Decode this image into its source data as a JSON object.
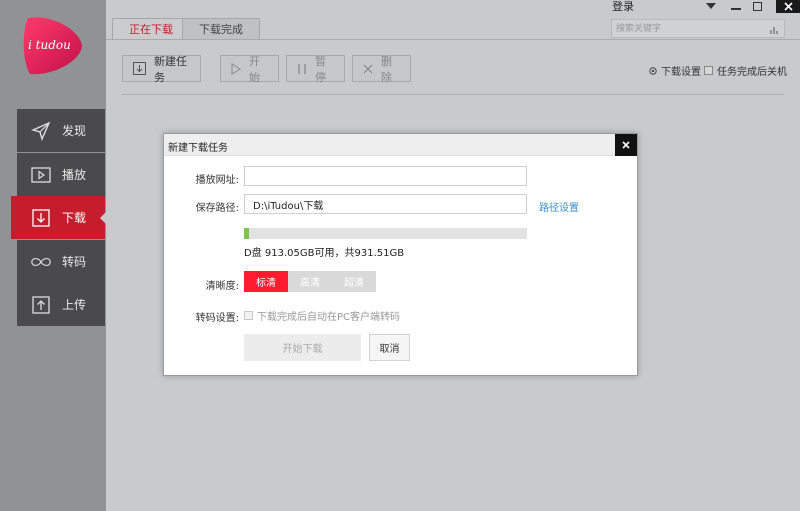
{
  "app": {
    "logo_text": "i tudou",
    "login_label": "登录",
    "search_placeholder": "搜索关键字",
    "colors": {
      "accent": "#c61c2c",
      "sidebar": "#919295",
      "nav_dark": "#4a4a4c",
      "quality_selected": "#fe1c2e",
      "link": "#3a8fd0",
      "progress": "#7ec24e"
    }
  },
  "sidebar": {
    "items": [
      {
        "label": "发现",
        "icon": "send-icon"
      },
      {
        "label": "播放",
        "icon": "play-icon"
      },
      {
        "label": "下载",
        "icon": "download-icon",
        "active": true
      },
      {
        "label": "转码",
        "icon": "infinity-icon"
      },
      {
        "label": "上传",
        "icon": "upload-icon"
      }
    ]
  },
  "tabs": [
    {
      "label": "正在下载",
      "active": true
    },
    {
      "label": "下载完成",
      "active": false
    }
  ],
  "toolbar": {
    "new_task": "新建任务",
    "start": "开始",
    "pause": "暂停",
    "delete": "删除",
    "download_settings": "下载设置",
    "shutdown_after": "任务完成后关机"
  },
  "dialog": {
    "title": "新建下载任务",
    "url_label": "播放网址:",
    "url_value": "",
    "path_label": "保存路径:",
    "path_value": "D:\\iTudou\\下载",
    "path_settings": "路径设置",
    "disk_usage_fraction": 0.018,
    "disk_text": "D盘 913.05GB可用，共931.51GB",
    "quality_label": "清晰度:",
    "quality_options": [
      "标清",
      "高清",
      "超清"
    ],
    "quality_selected": "标清",
    "transcode_label": "转码设置:",
    "transcode_option": "下载完成后自动在PC客户端转码",
    "start_button": "开始下载",
    "cancel_button": "取消"
  }
}
